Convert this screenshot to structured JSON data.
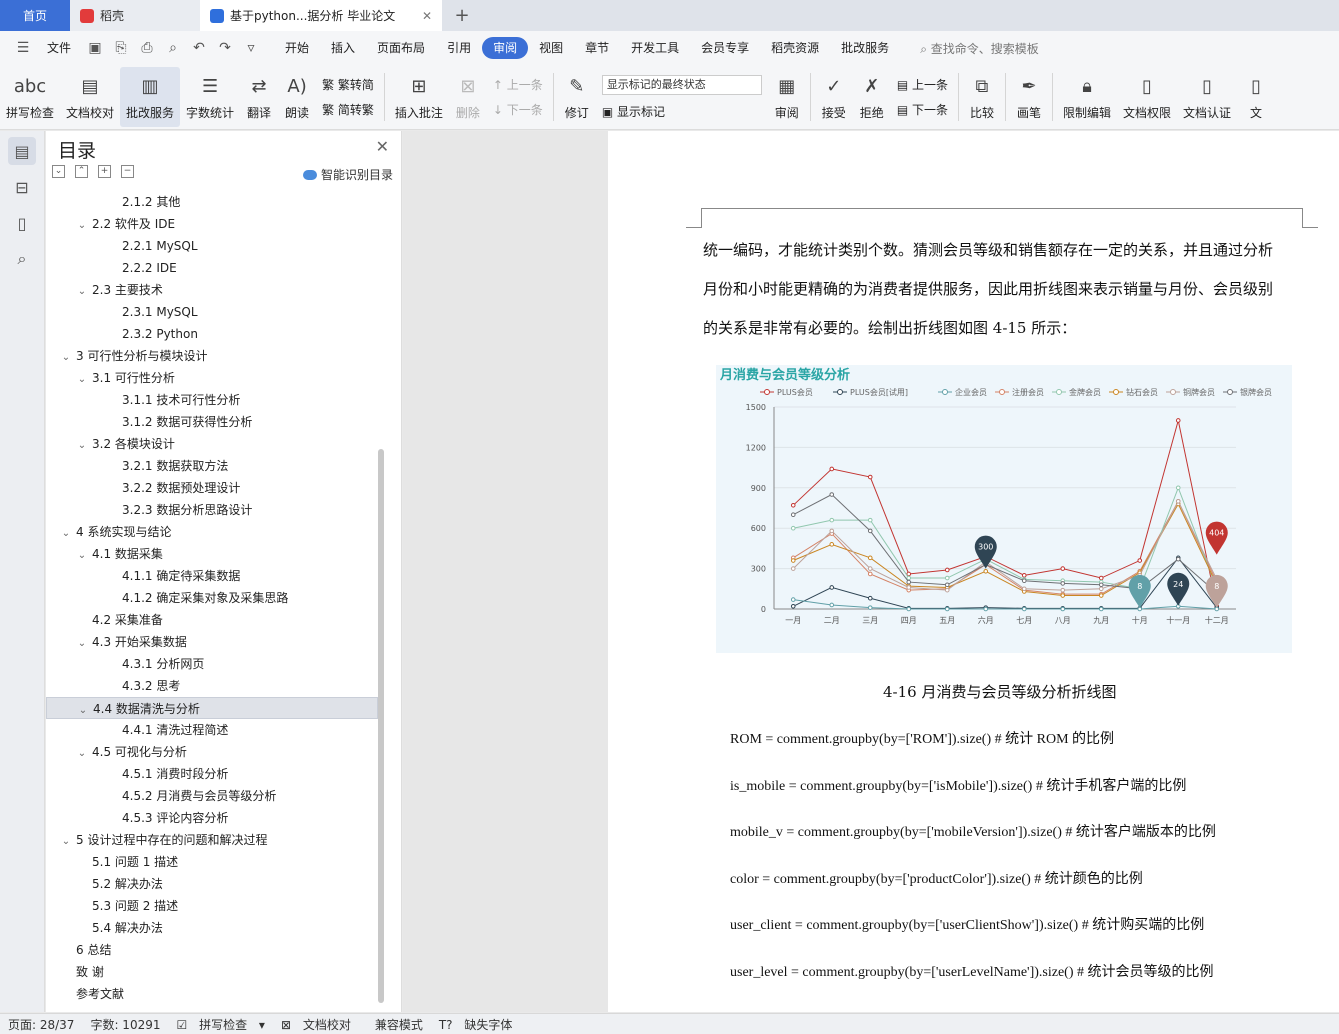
{
  "tabs": {
    "home": "首页",
    "docer": "稻壳",
    "active_doc": "基于python...据分析 毕业论文"
  },
  "menu": {
    "file": "文件",
    "items": [
      "开始",
      "插入",
      "页面布局",
      "引用",
      "审阅",
      "视图",
      "章节",
      "开发工具",
      "会员专享",
      "稻壳资源",
      "批改服务"
    ],
    "active": "审阅",
    "search": "查找命令、搜索模板"
  },
  "toolbar": {
    "spellcheck": "拼写检查",
    "doc_proof": "文档校对",
    "correct_service": "批改服务",
    "word_count": "字数统计",
    "translate": "翻译",
    "read_aloud": "朗读",
    "to_traditional": "繁转简",
    "to_simplified": "简转繁",
    "insert_comment": "插入批注",
    "delete": "删除",
    "prev": "上一条",
    "next": "下一条",
    "revise": "修订",
    "markup_select": "显示标记的最终状态",
    "show_markup": "显示标记",
    "review": "审阅",
    "accept": "接受",
    "reject": "拒绝",
    "prev2": "上一条",
    "next2": "下一条",
    "compare": "比较",
    "pen": "画笔",
    "restrict_edit": "限制编辑",
    "doc_rights": "文档权限",
    "doc_cert": "文档认证",
    "more": "文"
  },
  "toc": {
    "title": "目录",
    "smart": "智能识别目录",
    "items": [
      {
        "label": "2.1.2  其他",
        "level": 3,
        "arrow": false
      },
      {
        "label": "2.2 软件及 IDE",
        "level": 2,
        "arrow": true
      },
      {
        "label": "2.2.1 MySQL",
        "level": 3,
        "arrow": false
      },
      {
        "label": "2.2.2 IDE",
        "level": 3,
        "arrow": false
      },
      {
        "label": "2.3 主要技术",
        "level": 2,
        "arrow": true
      },
      {
        "label": "2.3.1 MySQL",
        "level": 3,
        "arrow": false
      },
      {
        "label": "2.3.2 Python",
        "level": 3,
        "arrow": false
      },
      {
        "label": "3  可行性分析与模块设计",
        "level": 1,
        "arrow": true
      },
      {
        "label": "3.1  可行性分析",
        "level": 2,
        "arrow": true
      },
      {
        "label": "3.1.1  技术可行性分析",
        "level": 3,
        "arrow": false
      },
      {
        "label": "3.1.2  数据可获得性分析",
        "level": 3,
        "arrow": false
      },
      {
        "label": "3.2  各模块设计",
        "level": 2,
        "arrow": true
      },
      {
        "label": "3.2.1  数据获取方法",
        "level": 3,
        "arrow": false
      },
      {
        "label": "3.2.2  数据预处理设计",
        "level": 3,
        "arrow": false
      },
      {
        "label": "3.2.3  数据分析思路设计",
        "level": 3,
        "arrow": false
      },
      {
        "label": "4  系统实现与结论",
        "level": 1,
        "arrow": true
      },
      {
        "label": "4.1 数据采集",
        "level": 2,
        "arrow": true
      },
      {
        "label": "4.1.1 确定待采集数据",
        "level": 3,
        "arrow": false
      },
      {
        "label": "4.1.2 确定采集对象及采集思路",
        "level": 3,
        "arrow": false
      },
      {
        "label": "4.2 采集准备",
        "level": 2,
        "arrow": false
      },
      {
        "label": "4.3 开始采集数据",
        "level": 2,
        "arrow": true
      },
      {
        "label": "4.3.1 分析网页",
        "level": 3,
        "arrow": false
      },
      {
        "label": "4.3.2 思考",
        "level": 3,
        "arrow": false
      },
      {
        "label": "4.4 数据清洗与分析",
        "level": 2,
        "arrow": true,
        "selected": true
      },
      {
        "label": "4.4.1 清洗过程简述",
        "level": 3,
        "arrow": false
      },
      {
        "label": "4.5  可视化与分析",
        "level": 2,
        "arrow": true
      },
      {
        "label": "4.5.1 消费时段分析",
        "level": 3,
        "arrow": false
      },
      {
        "label": "4.5.2 月消费与会员等级分析",
        "level": 3,
        "arrow": false
      },
      {
        "label": "4.5.3 评论内容分析",
        "level": 3,
        "arrow": false
      },
      {
        "label": "5  设计过程中存在的问题和解决过程",
        "level": 1,
        "arrow": true
      },
      {
        "label": "5.1 问题 1 描述",
        "level": 2,
        "arrow": false
      },
      {
        "label": "5.2 解决办法",
        "level": 2,
        "arrow": false
      },
      {
        "label": "5.3 问题 2 描述",
        "level": 2,
        "arrow": false
      },
      {
        "label": "5.4 解决办法",
        "level": 2,
        "arrow": false
      },
      {
        "label": "6  总结",
        "level": 1,
        "arrow": false
      },
      {
        "label": "致    谢",
        "level": 1,
        "arrow": false
      },
      {
        "label": "参考文献",
        "level": 1,
        "arrow": false
      }
    ]
  },
  "document": {
    "para1": "统一编码，才能统计类别个数。猜测会员等级和销售额存在一定的关系，并且通过分析",
    "para2": "月份和小时能更精确的为消费者提供服务，因此用折线图来表示销量与月份、会员级别",
    "para3": "的关系是非常有必要的。绘制出折线图如图 4-15 所示：",
    "caption": "4-16 月消费与会员等级分析折线图",
    "code": [
      "ROM = comment.groupby(by=['ROM']).size() #  统计 ROM 的比例",
      "is_mobile = comment.groupby(by=['isMobile']).size() #  统计手机客户端的比例",
      "mobile_v = comment.groupby(by=['mobileVersion']).size() #  统计客户端版本的比例",
      "color = comment.groupby(by=['productColor']).size() #  统计颜色的比例",
      "user_client = comment.groupby(by=['userClientShow']).size() #  统计购买端的比例",
      "user_level = comment.groupby(by=['userLevelName']).size() #  统计会员等级的比例"
    ]
  },
  "chart_data": {
    "type": "line",
    "title": "月消费与会员等级分析",
    "categories": [
      "一月",
      "二月",
      "三月",
      "四月",
      "五月",
      "六月",
      "七月",
      "八月",
      "九月",
      "十月",
      "十一月",
      "十二月"
    ],
    "ylim": [
      0,
      1500
    ],
    "yticks": [
      0,
      300,
      600,
      900,
      1200,
      1500
    ],
    "grid": true,
    "legend_position": "top",
    "series": [
      {
        "name": "PLUS会员",
        "color": "#c23531",
        "values": [
          770,
          1040,
          980,
          260,
          290,
          390,
          250,
          300,
          230,
          360,
          1400,
          20
        ]
      },
      {
        "name": "PLUS会员[试用]",
        "color": "#2f4554",
        "values": [
          20,
          160,
          80,
          5,
          5,
          10,
          5,
          5,
          5,
          5,
          380,
          10
        ]
      },
      {
        "name": "企业会员",
        "color": "#61a0a8",
        "values": [
          70,
          30,
          10,
          0,
          0,
          0,
          0,
          0,
          0,
          0,
          20,
          0
        ]
      },
      {
        "name": "注册会员",
        "color": "#d48265",
        "values": [
          380,
          560,
          260,
          140,
          150,
          330,
          140,
          110,
          110,
          280,
          800,
          200
        ]
      },
      {
        "name": "金牌会员",
        "color": "#91c7ae",
        "values": [
          600,
          660,
          660,
          230,
          230,
          370,
          220,
          210,
          200,
          150,
          900,
          150
        ]
      },
      {
        "name": "钻石会员",
        "color": "#ca8622",
        "values": [
          360,
          480,
          380,
          170,
          160,
          280,
          130,
          100,
          100,
          270,
          780,
          180
        ]
      },
      {
        "name": "铜牌会员",
        "color": "#bda29a",
        "values": [
          300,
          580,
          300,
          160,
          140,
          350,
          150,
          140,
          150,
          250,
          800,
          220
        ]
      },
      {
        "name": "银牌会员",
        "color": "#6e7074",
        "values": [
          700,
          850,
          580,
          200,
          180,
          330,
          210,
          190,
          180,
          150,
          370,
          120
        ]
      }
    ],
    "markers": [
      {
        "label": "300",
        "x": "六月",
        "value": 300,
        "color": "#2f4554"
      },
      {
        "label": "8",
        "x": "十月",
        "value": 8,
        "color": "#61a0a8"
      },
      {
        "label": "24",
        "x": "十一月",
        "value": 24,
        "color": "#2f4554"
      },
      {
        "label": "404",
        "x": "十二月",
        "value": 404,
        "color": "#c23531"
      },
      {
        "label": "8",
        "x": "十二月",
        "value": 8,
        "color": "#bda29a"
      }
    ]
  },
  "status": {
    "page": "页面: 28/37",
    "words": "字数: 10291",
    "spell": "拼写检查",
    "proof": "文档校对",
    "compat": "兼容模式",
    "font_missing": "缺失字体"
  }
}
